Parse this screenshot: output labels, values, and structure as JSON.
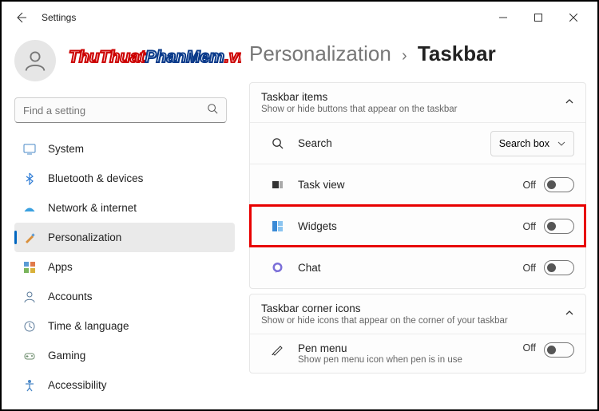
{
  "window": {
    "title": "Settings"
  },
  "watermark": {
    "part1": "ThuThuat",
    "part2": "PhanMem",
    "part3": ".vn"
  },
  "search": {
    "placeholder": "Find a setting"
  },
  "nav": [
    {
      "label": "System",
      "icon": "system-icon",
      "selected": false
    },
    {
      "label": "Bluetooth & devices",
      "icon": "bluetooth-icon",
      "selected": false
    },
    {
      "label": "Network & internet",
      "icon": "network-icon",
      "selected": false
    },
    {
      "label": "Personalization",
      "icon": "personalization-icon",
      "selected": true
    },
    {
      "label": "Apps",
      "icon": "apps-icon",
      "selected": false
    },
    {
      "label": "Accounts",
      "icon": "accounts-icon",
      "selected": false
    },
    {
      "label": "Time & language",
      "icon": "time-icon",
      "selected": false
    },
    {
      "label": "Gaming",
      "icon": "gaming-icon",
      "selected": false
    },
    {
      "label": "Accessibility",
      "icon": "accessibility-icon",
      "selected": false
    }
  ],
  "breadcrumb": {
    "parent": "Personalization",
    "sep": "›",
    "current": "Taskbar"
  },
  "sections": {
    "items": {
      "title": "Taskbar items",
      "subtitle": "Show or hide buttons that appear on the taskbar",
      "rows": [
        {
          "label": "Search",
          "control": "dropdown",
          "value": "Search box"
        },
        {
          "label": "Task view",
          "control": "toggle",
          "state": "Off"
        },
        {
          "label": "Widgets",
          "control": "toggle",
          "state": "Off",
          "highlight": true
        },
        {
          "label": "Chat",
          "control": "toggle",
          "state": "Off"
        }
      ]
    },
    "corner": {
      "title": "Taskbar corner icons",
      "subtitle": "Show or hide icons that appear on the corner of your taskbar",
      "rows": [
        {
          "label": "Pen menu",
          "sub": "Show pen menu icon when pen is in use",
          "control": "toggle",
          "state": "Off"
        }
      ]
    }
  }
}
